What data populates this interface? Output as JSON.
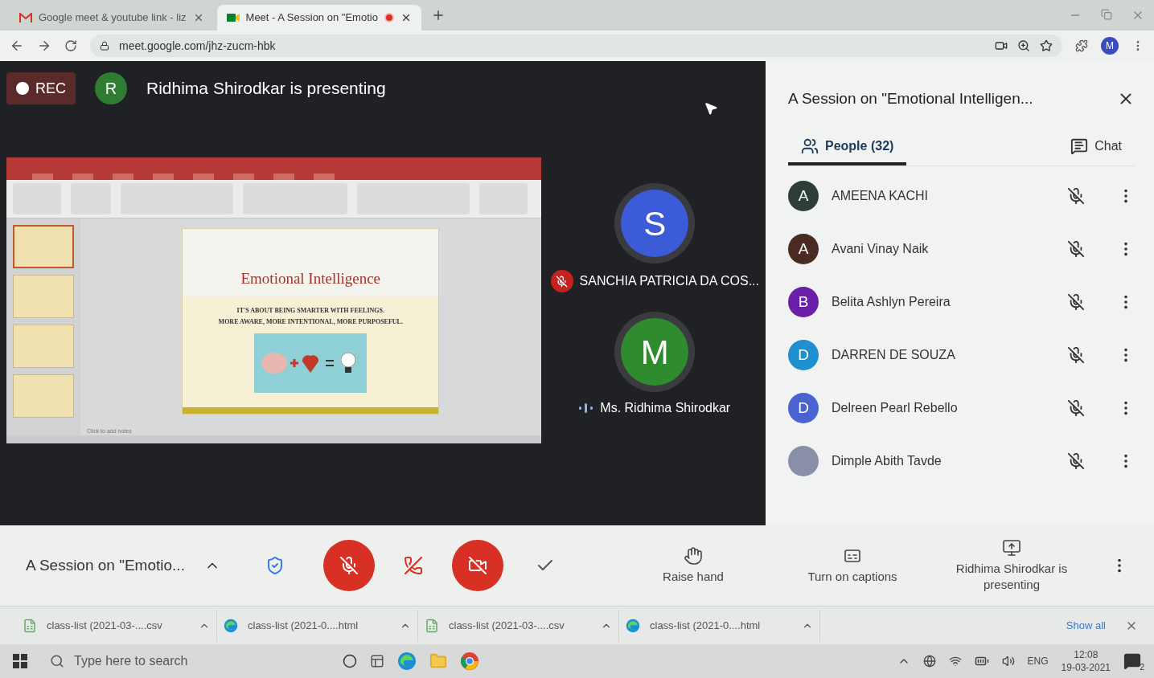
{
  "browser": {
    "tabs": [
      {
        "title": "Google meet & youtube link - liz",
        "kind": "gmail",
        "selected": false,
        "recording": false
      },
      {
        "title": "Meet - A Session on \"Emotio",
        "kind": "meet",
        "selected": true,
        "recording": true
      }
    ],
    "url": "meet.google.com/jhz-zucm-hbk",
    "profile_initial": "M"
  },
  "stage": {
    "rec_label": "REC",
    "presenter_initial": "R",
    "presenting_text": "Ridhima Shirodkar is presenting",
    "presentation": {
      "slide_title": "Emotional Intelligence",
      "slide_lines": [
        "IT'S ABOUT BEING SMARTER WITH FEELINGS.",
        "MORE AWARE, MORE INTENTIONAL, MORE PURPOSEFUL."
      ],
      "notes_placeholder": "Click to add notes"
    },
    "tiles": [
      {
        "initial": "S",
        "name": "SANCHIA PATRICIA DA COS...",
        "color": "#3b5bd8",
        "muted": true
      },
      {
        "initial": "M",
        "name": "Ms. Ridhima Shirodkar",
        "color": "#2e8b2e",
        "muted": false
      }
    ]
  },
  "panel": {
    "title": "A Session on \"Emotional Intelligen...",
    "tabs": [
      {
        "label": "People (32)",
        "kind": "people",
        "selected": true
      },
      {
        "label": "Chat",
        "kind": "chat",
        "selected": false
      }
    ],
    "people": [
      {
        "initial": "A",
        "name": "AMEENA KACHI",
        "kind": "letter",
        "color": "#2f3d3a"
      },
      {
        "initial": "A",
        "name": "Avani Vinay Naik",
        "kind": "letter",
        "color": "#4a2a22"
      },
      {
        "initial": "B",
        "name": "Belita Ashlyn Pereira",
        "kind": "letter",
        "color": "#6a1fa8"
      },
      {
        "initial": "D",
        "name": "DARREN DE SOUZA",
        "kind": "letter",
        "color": "#1f8fd0"
      },
      {
        "initial": "D",
        "name": "Delreen Pearl Rebello",
        "kind": "letter",
        "color": "#4a63d0"
      },
      {
        "name": "Dimple Abith Tavde",
        "kind": "photo"
      }
    ]
  },
  "controls": {
    "meeting_title": "A Session on \"Emotio...",
    "mic_on": false,
    "camera_on": false,
    "actions": [
      {
        "label": "Raise hand",
        "kind": "hand"
      },
      {
        "label": "Turn on captions",
        "kind": "captions"
      },
      {
        "label": "Ridhima Shirodkar is presenting",
        "kind": "present"
      }
    ]
  },
  "downloads": {
    "files": [
      {
        "name": "class-list (2021-03-....csv",
        "kind": "csv"
      },
      {
        "name": "class-list (2021-0....html",
        "kind": "html"
      },
      {
        "name": "class-list (2021-03-....csv",
        "kind": "csv"
      },
      {
        "name": "class-list (2021-0....html",
        "kind": "html"
      }
    ],
    "show_all": "Show all"
  },
  "taskbar": {
    "search_placeholder": "Type here to search",
    "language": "ENG",
    "time": "12:08",
    "date": "19-03-2021",
    "notification_count": "2"
  }
}
